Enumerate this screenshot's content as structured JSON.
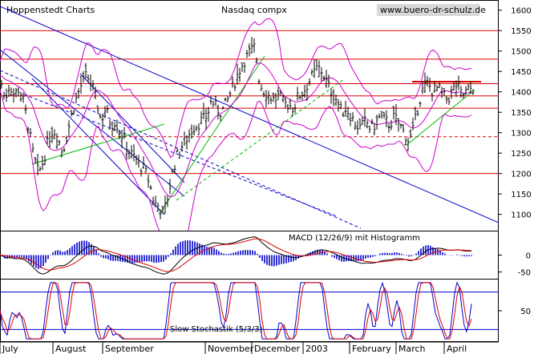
{
  "header": {
    "source": "Hoppenstedt Charts",
    "title": "Nasdaq compx",
    "website": "www.buero-dr-schulz.de"
  },
  "colors": {
    "background": "#ffffff",
    "price": "#000000",
    "bollinger": "#cc00cc",
    "support_resistance": "#dd0000",
    "trend_down": "#0000cc",
    "trend_up": "#00bb00",
    "macd_histogram": "#0000cc",
    "macd_signal": "#dd0000",
    "stochastic_k": "#0000cc",
    "stochastic_d": "#dd0000"
  },
  "x_axis": {
    "months": [
      "July",
      "August",
      "September",
      "November",
      "December",
      "2003",
      "February",
      "March",
      "April"
    ]
  },
  "chart_data": [
    {
      "type": "candlestick",
      "title": "Nasdaq compx",
      "y_ticks": [
        1100,
        1150,
        1200,
        1250,
        1300,
        1350,
        1400,
        1450,
        1500,
        1550,
        1600
      ],
      "ylim": [
        1060,
        1625
      ],
      "horizontal_lines": [
        1200,
        1290,
        1360,
        1390,
        1420,
        1480,
        1550
      ],
      "dashed_lines": [
        1290
      ],
      "resistance_segment": 1425,
      "price_path": [
        [
          0,
          1440
        ],
        [
          6,
          1380
        ],
        [
          12,
          1420
        ],
        [
          18,
          1390
        ],
        [
          24,
          1410
        ],
        [
          30,
          1370
        ],
        [
          36,
          1310
        ],
        [
          42,
          1240
        ],
        [
          48,
          1200
        ],
        [
          54,
          1230
        ],
        [
          60,
          1280
        ],
        [
          66,
          1310
        ],
        [
          72,
          1290
        ],
        [
          78,
          1250
        ],
        [
          84,
          1300
        ],
        [
          90,
          1350
        ],
        [
          96,
          1390
        ],
        [
          102,
          1420
        ],
        [
          108,
          1440
        ],
        [
          114,
          1420
        ],
        [
          120,
          1380
        ],
        [
          126,
          1330
        ],
        [
          132,
          1360
        ],
        [
          138,
          1320
        ],
        [
          144,
          1330
        ],
        [
          150,
          1300
        ],
        [
          156,
          1280
        ],
        [
          162,
          1250
        ],
        [
          168,
          1240
        ],
        [
          174,
          1220
        ],
        [
          180,
          1210
        ],
        [
          186,
          1180
        ],
        [
          192,
          1130
        ],
        [
          198,
          1120
        ],
        [
          204,
          1100
        ],
        [
          210,
          1150
        ],
        [
          216,
          1210
        ],
        [
          222,
          1250
        ],
        [
          228,
          1270
        ],
        [
          234,
          1290
        ],
        [
          240,
          1310
        ],
        [
          246,
          1320
        ],
        [
          252,
          1330
        ],
        [
          258,
          1340
        ],
        [
          264,
          1380
        ],
        [
          270,
          1360
        ],
        [
          276,
          1350
        ],
        [
          282,
          1370
        ],
        [
          288,
          1400
        ],
        [
          294,
          1430
        ],
        [
          300,
          1460
        ],
        [
          306,
          1480
        ],
        [
          312,
          1500
        ],
        [
          318,
          1510
        ],
        [
          324,
          1420
        ],
        [
          330,
          1400
        ],
        [
          336,
          1390
        ],
        [
          342,
          1380
        ],
        [
          348,
          1390
        ],
        [
          354,
          1370
        ],
        [
          360,
          1370
        ],
        [
          366,
          1360
        ],
        [
          372,
          1390
        ],
        [
          378,
          1400
        ],
        [
          384,
          1420
        ],
        [
          390,
          1440
        ],
        [
          396,
          1460
        ],
        [
          402,
          1450
        ],
        [
          408,
          1420
        ],
        [
          414,
          1400
        ],
        [
          420,
          1380
        ],
        [
          426,
          1350
        ],
        [
          432,
          1360
        ],
        [
          438,
          1340
        ],
        [
          444,
          1320
        ],
        [
          450,
          1310
        ],
        [
          456,
          1330
        ],
        [
          462,
          1310
        ],
        [
          468,
          1320
        ],
        [
          474,
          1340
        ],
        [
          480,
          1330
        ],
        [
          486,
          1320
        ],
        [
          492,
          1340
        ],
        [
          498,
          1320
        ],
        [
          504,
          1300
        ],
        [
          510,
          1280
        ],
        [
          516,
          1310
        ],
        [
          522,
          1370
        ],
        [
          528,
          1410
        ],
        [
          534,
          1420
        ],
        [
          540,
          1400
        ],
        [
          546,
          1410
        ],
        [
          552,
          1390
        ],
        [
          558,
          1380
        ],
        [
          564,
          1400
        ],
        [
          570,
          1420
        ],
        [
          576,
          1390
        ],
        [
          582,
          1400
        ],
        [
          588,
          1410
        ]
      ]
    },
    {
      "type": "bar",
      "title": "MACD (12/26/9) mit Histogramm",
      "y_ticks": [
        0,
        -50
      ],
      "ylim": [
        -70,
        70
      ]
    },
    {
      "type": "line",
      "title": "Slow Stochastik (5/3/3)",
      "y_ticks": [
        50
      ],
      "levels": [
        20,
        80
      ],
      "ylim": [
        0,
        100
      ]
    }
  ]
}
